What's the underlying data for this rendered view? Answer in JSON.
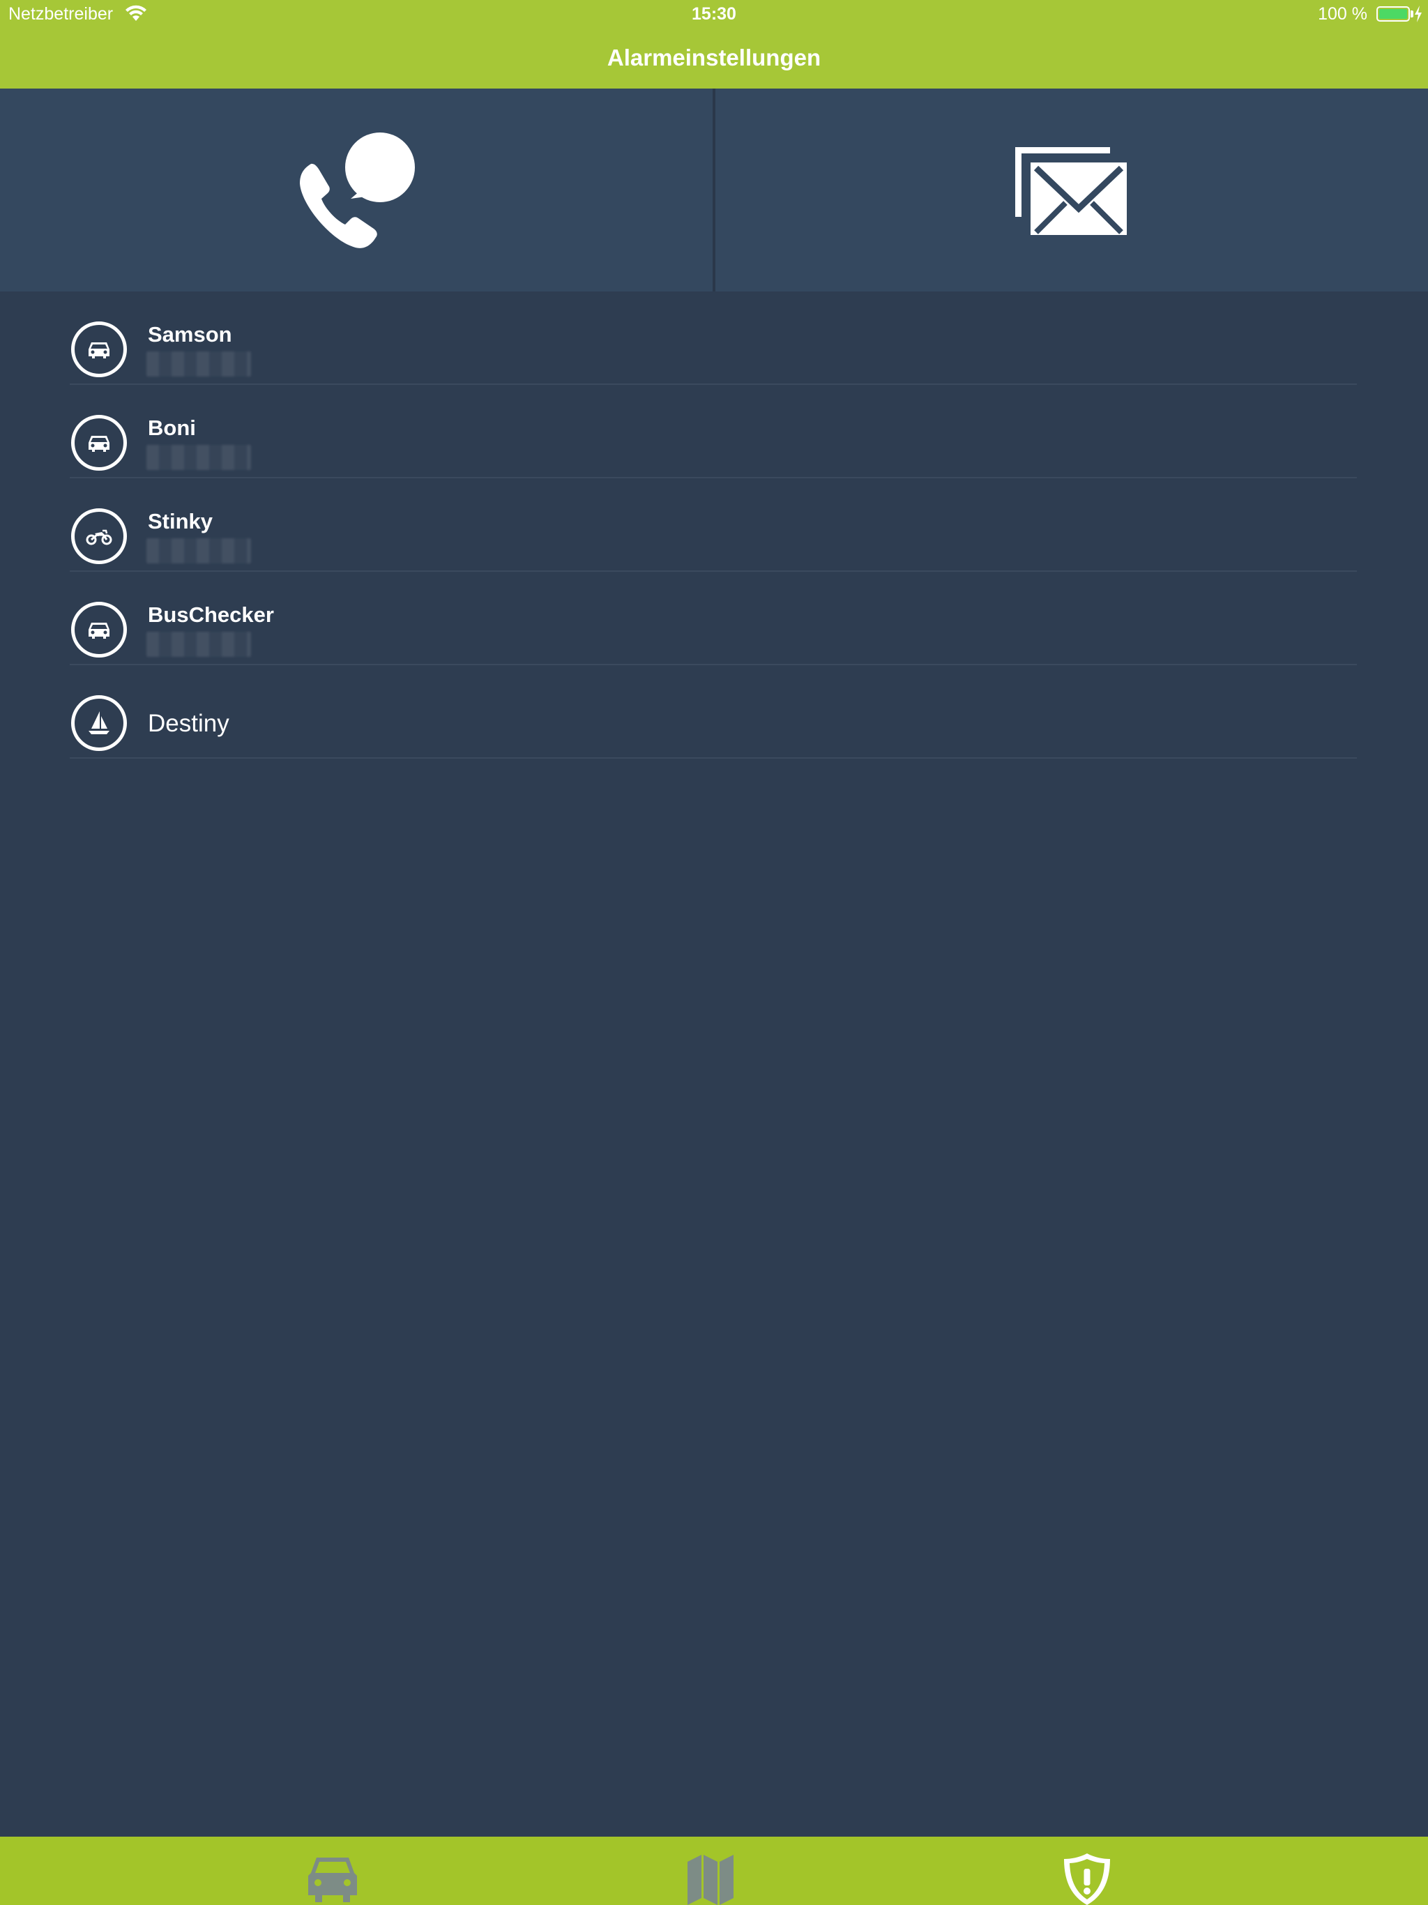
{
  "status_bar": {
    "carrier": "Netzbetreiber",
    "time": "15:30",
    "battery": "100 %"
  },
  "nav": {
    "title": "Alarmeinstellungen"
  },
  "actions": {
    "call_icon": "phone-speech-icon",
    "mail_icon": "envelopes-icon"
  },
  "vehicles": [
    {
      "name": "Samson",
      "icon": "car-icon",
      "subtitle_redacted": true
    },
    {
      "name": "Boni",
      "icon": "car-icon",
      "subtitle_redacted": true
    },
    {
      "name": "Stinky",
      "icon": "motorcycle-icon",
      "subtitle_redacted": true
    },
    {
      "name": "BusChecker",
      "icon": "car-icon",
      "subtitle_redacted": true
    },
    {
      "name": "Destiny",
      "icon": "sailboat-icon",
      "subtitle_redacted": false
    }
  ],
  "tabbar": {
    "tabs": [
      {
        "icon": "car-icon",
        "active": false
      },
      {
        "icon": "map-icon",
        "active": false
      },
      {
        "icon": "shield-alert-icon",
        "active": true
      }
    ]
  },
  "colors": {
    "brand_green": "#a6c737",
    "background": "#2e3d51",
    "tile": "#34485f",
    "inactive_tab": "#7d8c86"
  }
}
